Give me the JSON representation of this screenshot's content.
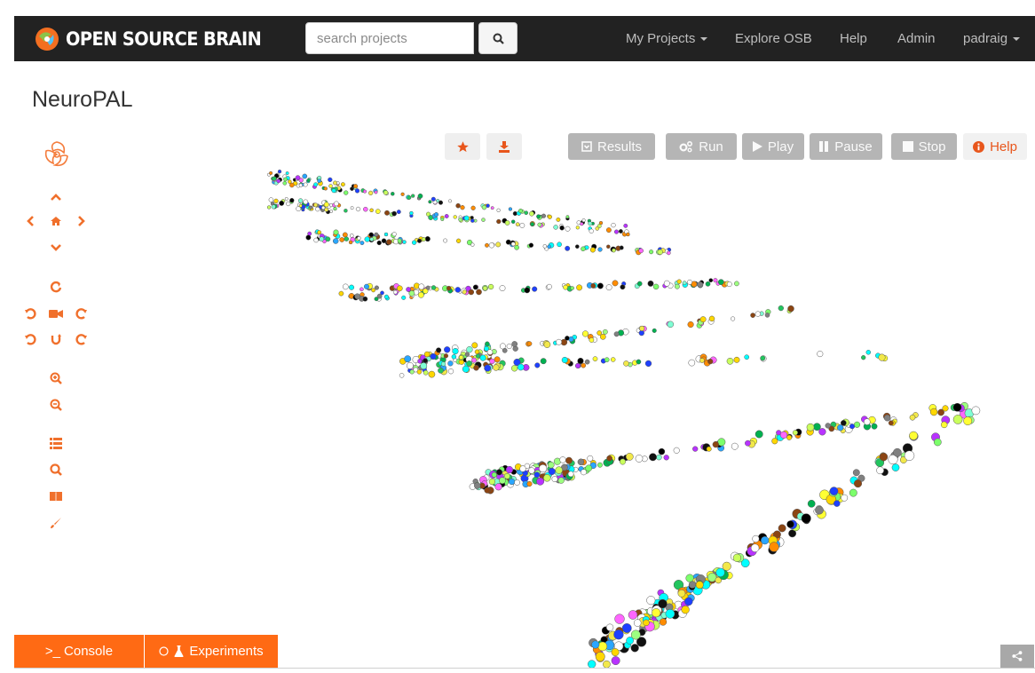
{
  "navbar": {
    "brand": "OPEN SOURCE BRAIN",
    "search_placeholder": "search projects",
    "menu": [
      "My Projects",
      "Explore OSB",
      "Help",
      "Admin",
      "padraig"
    ]
  },
  "page": {
    "title": "NeuroPAL"
  },
  "toolbar": {
    "results_label": "Results",
    "run_label": "Run",
    "play_label": "Play",
    "pause_label": "Pause",
    "stop_label": "Stop",
    "help_label": "Help"
  },
  "bottom": {
    "console_label": "Console",
    "experiments_label": "Experiments"
  },
  "colors": {
    "accent": "#ff6a14",
    "navbar": "#222222",
    "disabled_button": "#b5b5b5"
  },
  "icons": [
    "logo-icon",
    "search-icon",
    "star-icon",
    "download-icon",
    "results-icon",
    "gears-icon",
    "play-icon",
    "pause-icon",
    "stop-icon",
    "info-icon",
    "share-icon"
  ]
}
